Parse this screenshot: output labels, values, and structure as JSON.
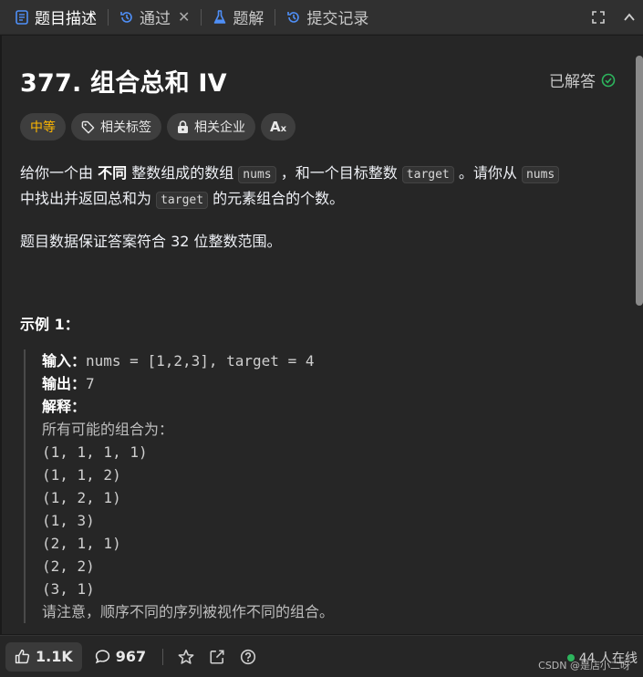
{
  "tabs": [
    {
      "label": "题目描述",
      "icon": "description-icon",
      "active": true
    },
    {
      "label": "通过",
      "icon": "history-icon",
      "closable": true
    },
    {
      "label": "题解",
      "icon": "flask-icon"
    },
    {
      "label": "提交记录",
      "icon": "history-icon"
    }
  ],
  "tab_close": "✕",
  "problem": {
    "title": "377. 组合总和 IV",
    "status": "已解答",
    "status_color": "#2db55d",
    "difficulty": "中等",
    "difficulty_color": "#ffb800",
    "tags": [
      "相关标签",
      "相关企业"
    ],
    "translate_label": "A",
    "translate_sub": "x"
  },
  "description": {
    "p1_a": "给你一个由 ",
    "p1_bold": "不同",
    "p1_b": " 整数组成的数组 ",
    "code_nums": "nums",
    "p1_c": " ，和一个目标整数 ",
    "code_target": "target",
    "p1_d": " 。请你从 ",
    "p1_e": "中找出并返回总和为 ",
    "p1_f": " 的元素组合的个数。",
    "p2": "题目数据保证答案符合 32 位整数范围。"
  },
  "example": {
    "title": "示例 1：",
    "input_label": "输入：",
    "input_value": "nums = [1,2,3], target = 4",
    "output_label": "输出：",
    "output_value": "7",
    "explain_label": "解释：",
    "lines": [
      "所有可能的组合为：",
      "(1, 1, 1, 1)",
      "(1, 1, 2)",
      "(1, 2, 1)",
      "(1, 3)",
      "(2, 1, 1)",
      "(2, 2)",
      "(3, 1)",
      "请注意，顺序不同的序列被视作不同的组合。"
    ]
  },
  "footer": {
    "likes": "1.1K",
    "comments": "967",
    "online": "44 人在线",
    "watermark": "CSDN @是店小二呀"
  }
}
